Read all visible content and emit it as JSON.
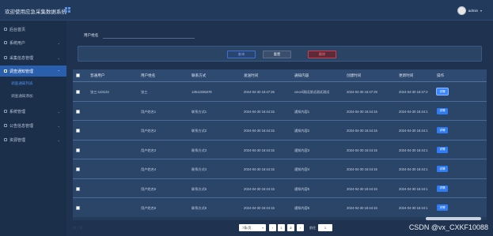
{
  "header": {
    "title": "欢迎使用应急采集数据系统",
    "user_name": "admin",
    "caret": "▾"
  },
  "sidebar": {
    "items": [
      {
        "label": "后台首页",
        "icon": "home-icon"
      },
      {
        "label": "系统用户",
        "icon": "user-icon"
      },
      {
        "label": "采集信息管理",
        "icon": "collect-icon"
      },
      {
        "label": "调查通知管理",
        "icon": "notice-icon"
      },
      {
        "label": "系统管理",
        "icon": "system-icon"
      },
      {
        "label": "公告信息管理",
        "icon": "announce-icon"
      },
      {
        "label": "资源管理",
        "icon": "resource-icon"
      }
    ],
    "sub_items": [
      "调查通知列表",
      "调查通知添加"
    ]
  },
  "search": {
    "label": "用户姓名",
    "value": "",
    "placeholder": ""
  },
  "buttons": {
    "search": "查询",
    "reset": "重置",
    "delete": "删除"
  },
  "table": {
    "columns": [
      "普通用户",
      "用户姓名",
      "联系方式",
      "发送时间",
      "通知内容",
      "创建时间",
      "更新时间",
      "操作"
    ],
    "rows": [
      [
        "张三-123123",
        "张三",
        "13512345678",
        "2024-04-30 16:47:26",
        "ceceil测试测试测试测试",
        "2024-04-30 16:47:29",
        "2024-04-30 16:47:2"
      ],
      [
        "",
        "用户姓名1",
        "联系方式1",
        "2024-04-30 16:44:15",
        "通知内容1",
        "2024-04-30 16:44:15",
        "2024-04-30 16:44:1"
      ],
      [
        "",
        "用户姓名2",
        "联系方式2",
        "2024-04-30 16:44:15",
        "通知内容2",
        "2024-04-30 16:44:15",
        "2024-04-30 16:44:1"
      ],
      [
        "",
        "用户姓名3",
        "联系方式3",
        "2024-04-30 16:44:15",
        "通知内容3",
        "2024-04-30 16:44:15",
        "2024-04-30 16:44:1"
      ],
      [
        "",
        "用户姓名4",
        "联系方式4",
        "2024-04-30 16:44:15",
        "通知内容4",
        "2024-04-30 16:44:15",
        "2024-04-30 16:44:1"
      ],
      [
        "",
        "用户姓名5",
        "联系方式5",
        "2024-04-30 16:44:15",
        "通知内容5",
        "2024-04-30 16:44:15",
        "2024-04-30 16:44:1"
      ],
      [
        "",
        "用户姓名6",
        "联系方式6",
        "2024-04-30 16:44:15",
        "通知内容6",
        "2024-04-30 16:44:15",
        "2024-04-30 16:44:1"
      ]
    ],
    "action_label": "详情"
  },
  "pager": {
    "total": "共 7 条",
    "page_size": "7条/页",
    "pages": [
      "1",
      "2"
    ],
    "prev": "‹",
    "next": "›",
    "goto_label": "前往",
    "goto_value": "1"
  },
  "watermark": "CSDN @vx_CXKF10088",
  "colors": {
    "background": "#1f3350",
    "accent": "#2f7bf2",
    "danger": "#d23a4e",
    "sidebar_active": "#2a5fae"
  }
}
